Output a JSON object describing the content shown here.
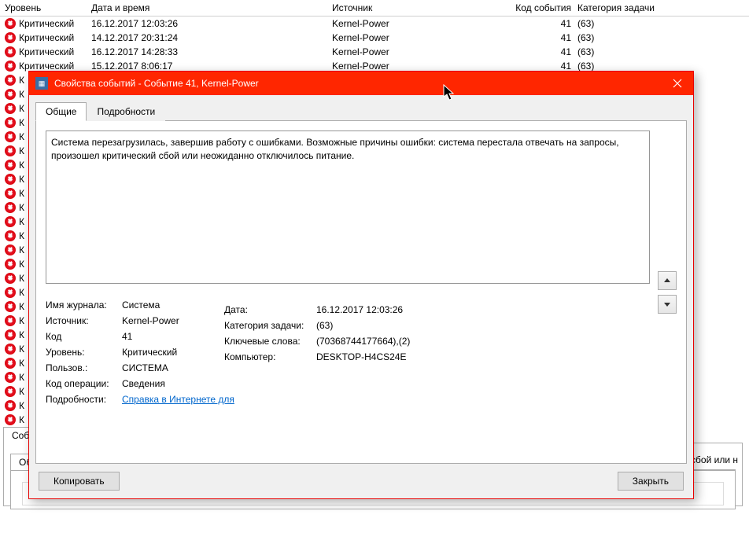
{
  "table": {
    "headers": {
      "level": "Уровень",
      "date": "Дата и время",
      "source": "Источник",
      "code": "Код события",
      "category": "Категория задачи"
    },
    "rows": [
      {
        "level": "Критический",
        "date": "16.12.2017 12:03:26",
        "source": "Kernel-Power",
        "code": "41",
        "category": "(63)"
      },
      {
        "level": "Критический",
        "date": "14.12.2017 20:31:24",
        "source": "Kernel-Power",
        "code": "41",
        "category": "(63)"
      },
      {
        "level": "Критический",
        "date": "16.12.2017 14:28:33",
        "source": "Kernel-Power",
        "code": "41",
        "category": "(63)"
      },
      {
        "level": "Критический",
        "date": "15.12.2017 8:06:17",
        "source": "Kernel-Power",
        "code": "41",
        "category": "(63)"
      }
    ],
    "truncated_label": "К"
  },
  "dialog": {
    "title": "Свойства событий - Событие 41, Kernel-Power",
    "tabs": {
      "general": "Общие",
      "details": "Подробности"
    },
    "description": "Система перезагрузилась, завершив работу с ошибками. Возможные причины ошибки: система перестала отвечать на запросы, произошел критический сбой или неожиданно отключилось питание.",
    "fields": {
      "log_label": "Имя журнала:",
      "log_value": "Система",
      "source_label": "Источник:",
      "source_value": "Kernel-Power",
      "date_label": "Дата:",
      "date_value": "16.12.2017 12:03:26",
      "code_label": "Код",
      "code_value": "41",
      "category_label": "Категория задачи:",
      "category_value": "(63)",
      "level_label": "Уровень:",
      "level_value": "Критический",
      "keywords_label": "Ключевые слова:",
      "keywords_value": "(70368744177664),(2)",
      "user_label": "Пользов.:",
      "user_value": "СИСТЕМА",
      "computer_label": "Компьютер:",
      "computer_value": "DESKTOP-H4CS24E",
      "opcode_label": "Код операции:",
      "opcode_value": "Сведения",
      "details_label": "Подробности:",
      "details_link": "Справка в Интернете для "
    },
    "buttons": {
      "copy": "Копировать",
      "close": "Закрыть"
    }
  },
  "background": {
    "tab1": "Соб",
    "tab2": "Об",
    "partial_text": "й сбой или н"
  }
}
